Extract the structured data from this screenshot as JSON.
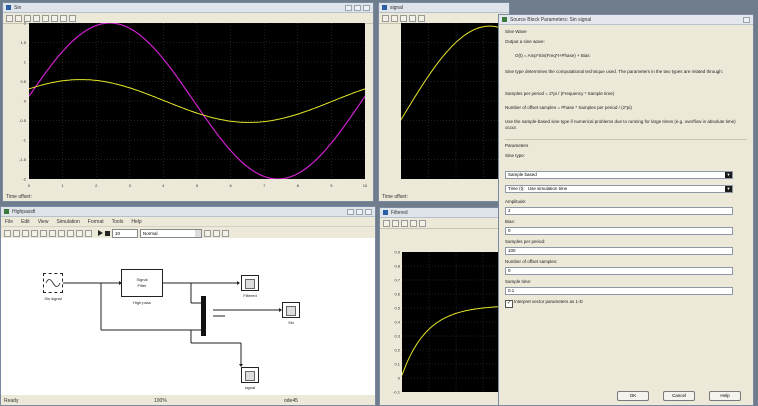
{
  "scope1": {
    "title": "Sin",
    "status": "Time offset:",
    "x_ticks": [
      "0",
      "1",
      "2",
      "3",
      "4",
      "5",
      "6",
      "7",
      "8",
      "9",
      "10"
    ],
    "y_ticks": [
      "2",
      "1.5",
      "1",
      "0.5",
      "0",
      "-0.5",
      "-1",
      "-1.5",
      "-2"
    ],
    "colors": {
      "magenta": "#d020d0",
      "yellow": "#e6e62a",
      "grid": "#444444"
    }
  },
  "scope2": {
    "title": "signal",
    "status": "Time offset:"
  },
  "scope3": {
    "title": "Filtered",
    "status": "Time offset:",
    "y_ticks": [
      "0.9",
      "0.8",
      "0.7",
      "0.6",
      "0.5",
      "0.4",
      "0.3",
      "0.2",
      "0.1",
      "0",
      "-0.1"
    ]
  },
  "model": {
    "title": "Highpassfi",
    "menu": [
      "File",
      "Edit",
      "View",
      "Simulation",
      "Format",
      "Tools",
      "Help"
    ],
    "stop_time": "10",
    "mode": "Normal",
    "status_left": "Ready",
    "status_mid": "100%",
    "status_right": "ode45",
    "blocks": {
      "sine_label": "Sin signal",
      "filter_line1": "Signal",
      "filter_line2": "Filter",
      "filter_caption": "High pass",
      "filtered_label": "Filtered",
      "sin_label": "Sin",
      "signal_label": "signal"
    }
  },
  "dialog": {
    "title": "Source Block Parameters: Sin signal",
    "section": "Sine Wave",
    "desc1": "Output a sine wave:",
    "formula": "O(t) = Amp*Sin(Freq*t+Phase) + Bias",
    "desc2": "Sine type determines the computational technique used. The parameters in the two types are related through:",
    "desc3": "Samples per period = 2*pi / (Frequency * Sample time)",
    "desc4": "Number of offset samples = Phase * Samples per period / (2*pi)",
    "desc5": "Use the sample-based sine type if numerical problems due to running for large times (e.g. overflow in absolute time) occur.",
    "params_heading": "Parameters",
    "sine_type_label": "Sine type:",
    "sine_type_value": "Sample based",
    "time_label": "Time (t):",
    "time_value": "Use simulation time",
    "amplitude_label": "Amplitude:",
    "amplitude_value": "2",
    "bias_label": "Bias:",
    "bias_value": "0",
    "samples_label": "Samples per period:",
    "samples_value": "100",
    "offset_label": "Number of offset samples:",
    "offset_value": "0",
    "sampletime_label": "Sample time:",
    "sampletime_value": "0.1",
    "interpret_label": "Interpret vector parameters as 1-D",
    "ok": "OK",
    "cancel": "Cancel",
    "help": "Help"
  }
}
